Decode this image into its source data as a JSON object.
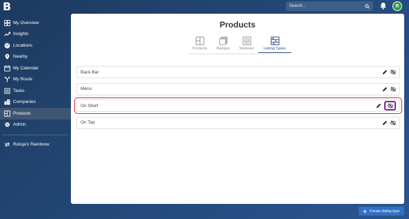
{
  "app": {
    "logo_letter": "B"
  },
  "search": {
    "placeholder": "Search..."
  },
  "user": {
    "initial": "R"
  },
  "sidebar": {
    "items": [
      {
        "label": "My Overview",
        "icon": "dashboard-icon"
      },
      {
        "label": "Insights",
        "icon": "trend-icon"
      },
      {
        "label": "Locations",
        "icon": "globe-icon"
      },
      {
        "label": "Nearby",
        "icon": "pin-icon"
      },
      {
        "label": "My Calendar",
        "icon": "calendar-icon"
      },
      {
        "label": "My Route",
        "icon": "route-icon"
      },
      {
        "label": "Tasks",
        "icon": "tasks-icon"
      },
      {
        "label": "Companies",
        "icon": "building-icon"
      },
      {
        "label": "Products",
        "icon": "products-icon"
      },
      {
        "label": "Admin",
        "icon": "gear-icon"
      }
    ],
    "brewery": "Rutuja's Rainbrew"
  },
  "main": {
    "title": "Products",
    "tabs": [
      {
        "label": "Products"
      },
      {
        "label": "Ranges"
      },
      {
        "label": "Statuses"
      },
      {
        "label": "Listing Types"
      }
    ],
    "rows": [
      {
        "label": "Back Bar"
      },
      {
        "label": "Menu"
      },
      {
        "label": "On Shelf"
      },
      {
        "label": "On Tap"
      }
    ],
    "create_label": "Create listing type"
  },
  "colors": {
    "accent": "#2a4e7f",
    "highlight_box": "#d8252d",
    "focus_box": "#7b1f94",
    "button": "#2f70c6"
  }
}
